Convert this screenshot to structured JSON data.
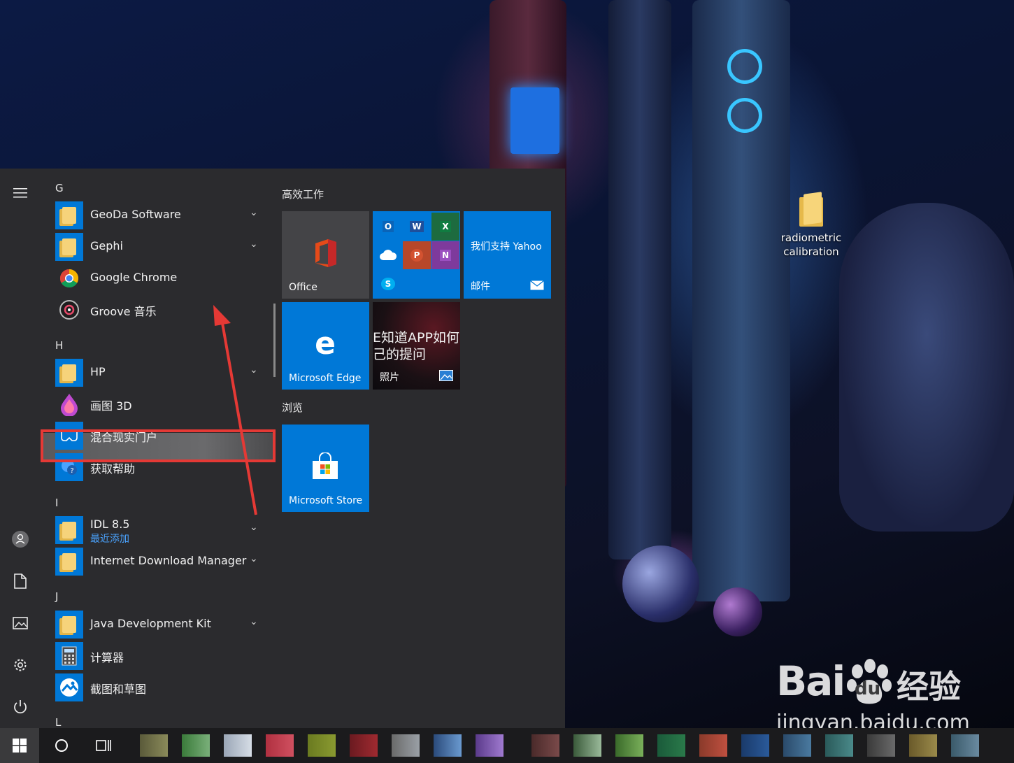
{
  "desktop": {
    "icons": [
      {
        "label_line1": "radiometric",
        "label_line2": "calibration"
      }
    ]
  },
  "start_menu": {
    "sections": [
      {
        "letter": "G"
      },
      {
        "letter": "H"
      },
      {
        "letter": "I"
      },
      {
        "letter": "J"
      },
      {
        "letter": "L"
      }
    ],
    "apps": [
      {
        "name": "GeoDa Software",
        "expandable": true
      },
      {
        "name": "Gephi",
        "expandable": true
      },
      {
        "name": "Google Chrome",
        "expandable": false,
        "highlighted": true
      },
      {
        "name": "Groove 音乐",
        "expandable": false
      },
      {
        "name": "HP",
        "expandable": true
      },
      {
        "name": "画图 3D",
        "expandable": false
      },
      {
        "name": "混合现实门户",
        "expandable": false
      },
      {
        "name": "获取帮助",
        "expandable": false
      },
      {
        "name": "IDL 8.5",
        "subtitle": "最近添加",
        "expandable": true
      },
      {
        "name": "Internet Download Manager",
        "expandable": true
      },
      {
        "name": "Java Development Kit",
        "expandable": true
      },
      {
        "name": "计算器",
        "expandable": false
      },
      {
        "name": "截图和草图",
        "expandable": false
      }
    ],
    "tile_groups": [
      {
        "title": "高效工作"
      },
      {
        "title": "浏览"
      }
    ],
    "tiles": {
      "office": "Office",
      "yahoo_text": "我们支持 Yahoo",
      "mail": "邮件",
      "edge": "Microsoft Edge",
      "photos": "照片",
      "photos_overlay_line1": "E知道APP如何",
      "photos_overlay_line2": "己的提问",
      "store": "Microsoft Store"
    },
    "rail_icons": [
      "hamburger-menu-icon",
      "user-icon",
      "document-icon",
      "pictures-icon",
      "settings-icon",
      "power-icon"
    ]
  },
  "watermark": {
    "brand": "Bai",
    "brand2": "du",
    "product": "经验",
    "url": "jingyan.baidu.com"
  },
  "colors": {
    "accent": "#0078d7",
    "menu_bg": "#2b2b2e",
    "highlight_border": "#e53935",
    "taskbar_bg": "#1b1b1d"
  }
}
